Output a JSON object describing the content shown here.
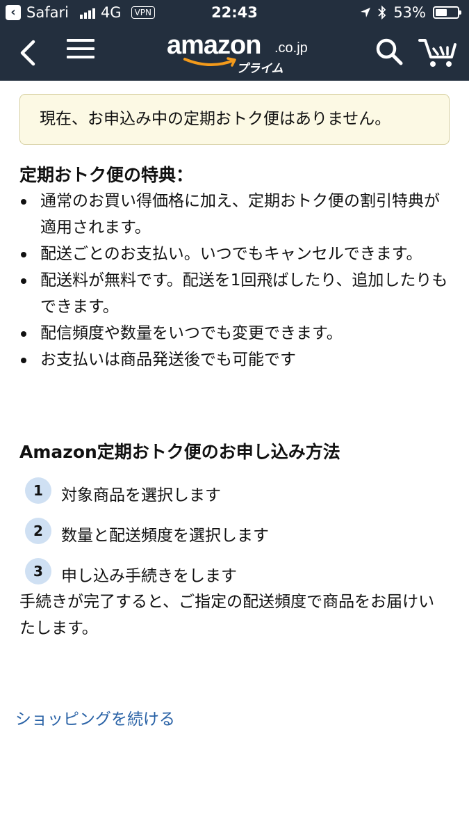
{
  "status_bar": {
    "carrier": "Safari",
    "network": "4G",
    "vpn": "VPN",
    "time": "22:43",
    "battery": "53%",
    "battery_level": 0.53
  },
  "navbar": {
    "logo_word": "amazon",
    "logo_domain": ".co.jp",
    "logo_sub": "プライム"
  },
  "notice": {
    "text": "現在、お申込み中の定期おトク便はありません。"
  },
  "benefits": {
    "heading": "定期おトク便の特典：",
    "items": [
      "通常のお買い得価格に加え、定期おトク便の割引特典が適用されます。",
      "配送ごとのお支払い。いつでもキャンセルできます。",
      "配送料が無料です。配送を1回飛ばしたり、追加したりもできます。",
      "配信頻度や数量をいつでも変更できます。",
      "お支払いは商品発送後でも可能です"
    ]
  },
  "howto": {
    "heading": "Amazon定期おトク便のお申し込み方法",
    "steps": [
      {
        "num": "1",
        "text": "対象商品を選択します"
      },
      {
        "num": "2",
        "text": "数量と配送頻度を選択します"
      },
      {
        "num": "3",
        "text": "申し込み手続きをします"
      }
    ],
    "note": "手続きが完了すると、ご指定の配送頻度で商品をお届けいたします。"
  },
  "links": {
    "continue": "ショッピングを続ける"
  }
}
